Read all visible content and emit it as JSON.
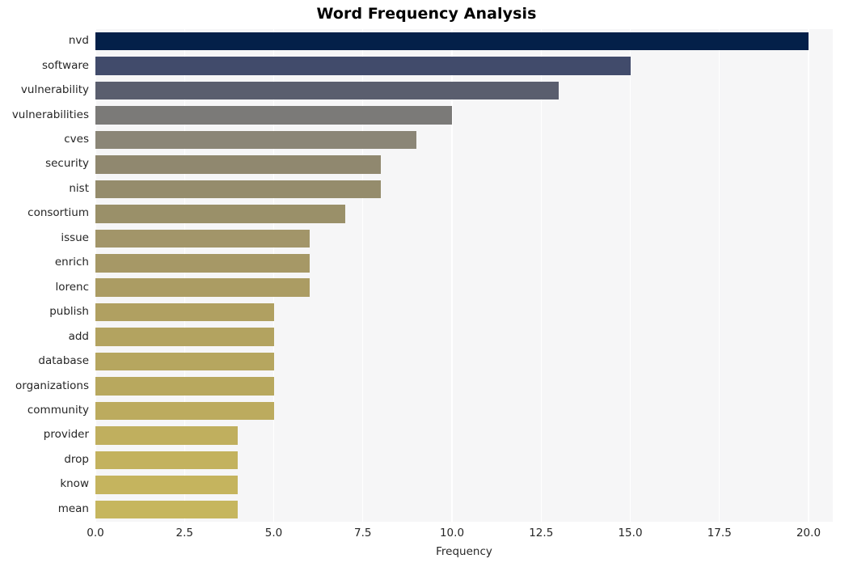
{
  "chart_data": {
    "type": "bar",
    "orientation": "horizontal",
    "title": "Word Frequency Analysis",
    "xlabel": "Frequency",
    "ylabel": "",
    "xlim": [
      0,
      20.68
    ],
    "xticks": [
      0.0,
      2.5,
      5.0,
      7.5,
      10.0,
      12.5,
      15.0,
      17.5,
      20.0
    ],
    "xtick_labels": [
      "0.0",
      "2.5",
      "5.0",
      "7.5",
      "10.0",
      "12.5",
      "15.0",
      "17.5",
      "20.0"
    ],
    "grid": true,
    "grid_axis": "x",
    "legend": "none",
    "categories": [
      "nvd",
      "software",
      "vulnerability",
      "vulnerabilities",
      "cves",
      "security",
      "nist",
      "consortium",
      "issue",
      "enrich",
      "lorenc",
      "publish",
      "add",
      "database",
      "organizations",
      "community",
      "provider",
      "drop",
      "know",
      "mean"
    ],
    "values": [
      20,
      15,
      13,
      10,
      9,
      8,
      8,
      7,
      6,
      6,
      6,
      5,
      5,
      5,
      5,
      5,
      4,
      4,
      4,
      4
    ],
    "bar_colors": [
      "#042049",
      "#414b6b",
      "#5a5e6e",
      "#7b7a78",
      "#8b8677",
      "#90886f",
      "#958c6c",
      "#9a9069",
      "#a29569",
      "#a69866",
      "#ab9c63",
      "#b0a061",
      "#b3a360",
      "#b6a65f",
      "#b8a85e",
      "#bcab5e",
      "#c0af5e",
      "#c3b25e",
      "#c5b45e",
      "#c6b65e"
    ],
    "plot_background": "#f6f6f7",
    "figure_background": "#ffffff",
    "gridline_color": "#ffffff",
    "tick_label_color": "#262626"
  }
}
